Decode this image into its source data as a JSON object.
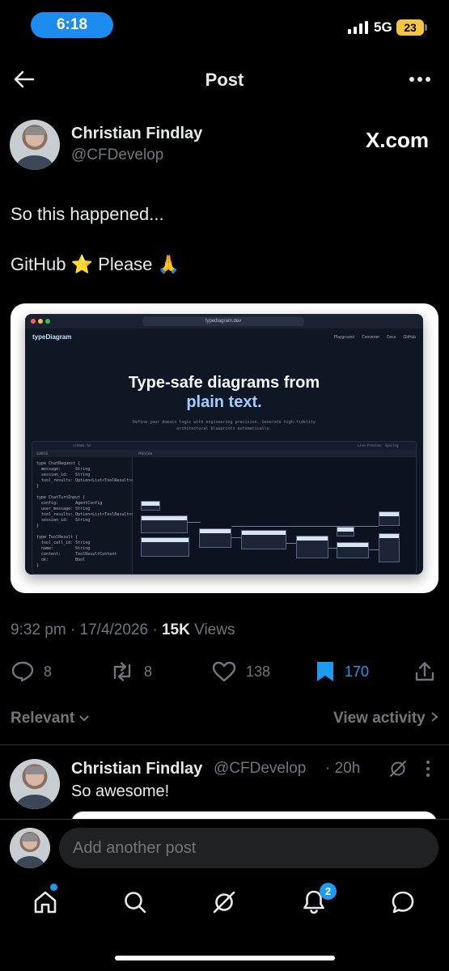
{
  "status_bar": {
    "time": "6:18",
    "network": "5G",
    "battery": "23"
  },
  "header": {
    "title": "Post"
  },
  "post": {
    "author_name": "Christian Findlay",
    "author_handle": "@CFDevelop",
    "source_label": "X.com",
    "line1": "So this happened...",
    "line2_text": "GitHub",
    "line2_suffix": "Please",
    "time": "9:32 pm",
    "date": "17/4/2026",
    "views_count": "15K",
    "views_label": "Views",
    "media": {
      "url": "typediagram.dev",
      "site_name": "typeDiagram",
      "nav": [
        "Playground",
        "Converter",
        "Docs",
        "GitHub"
      ],
      "hero_line1": "Type-safe diagrams from",
      "hero_line2": "plain text.",
      "hero_sub": "Define your domain logic with engineering precision. Generate high-fidelity architectural blueprints automatically.",
      "file_name": "schema.td",
      "source_label": "SOURCE",
      "preview_label": "PREVIEW",
      "live_preview": "Live Preview: Syncing",
      "code": "type ChatRequest {\n  message:      String\n  session_id:   String\n  tool_results: Option<List<ToolResult>>\n}\n\ntype ChatTurnInput {\n  config:       AgentConfig\n  user_message: String\n  tool_results: Option<List<ToolResult>>\n  session_id:   String\n}\n\ntype ToolResult {\n  tool_call_id: String\n  name:         String\n  content:      ToolResultContent\n  ok:           Bool\n}\n\nunion ToolResultContent {\n  None\n  Scalar { value: String }"
    }
  },
  "actions": {
    "replies": "8",
    "reposts": "8",
    "likes": "138",
    "bookmarks": "170"
  },
  "filter": {
    "relevant": "Relevant",
    "view_activity": "View activity"
  },
  "reply": {
    "author_name": "Christian Findlay",
    "author_handle": "@CFDevelop",
    "time": "20h",
    "text": "So awesome!"
  },
  "composer": {
    "placeholder": "Add another post"
  },
  "nav": {
    "notifications_badge": "2"
  },
  "colors": {
    "accent": "#1d9bf0",
    "background": "#000000",
    "muted": "#71767b"
  }
}
